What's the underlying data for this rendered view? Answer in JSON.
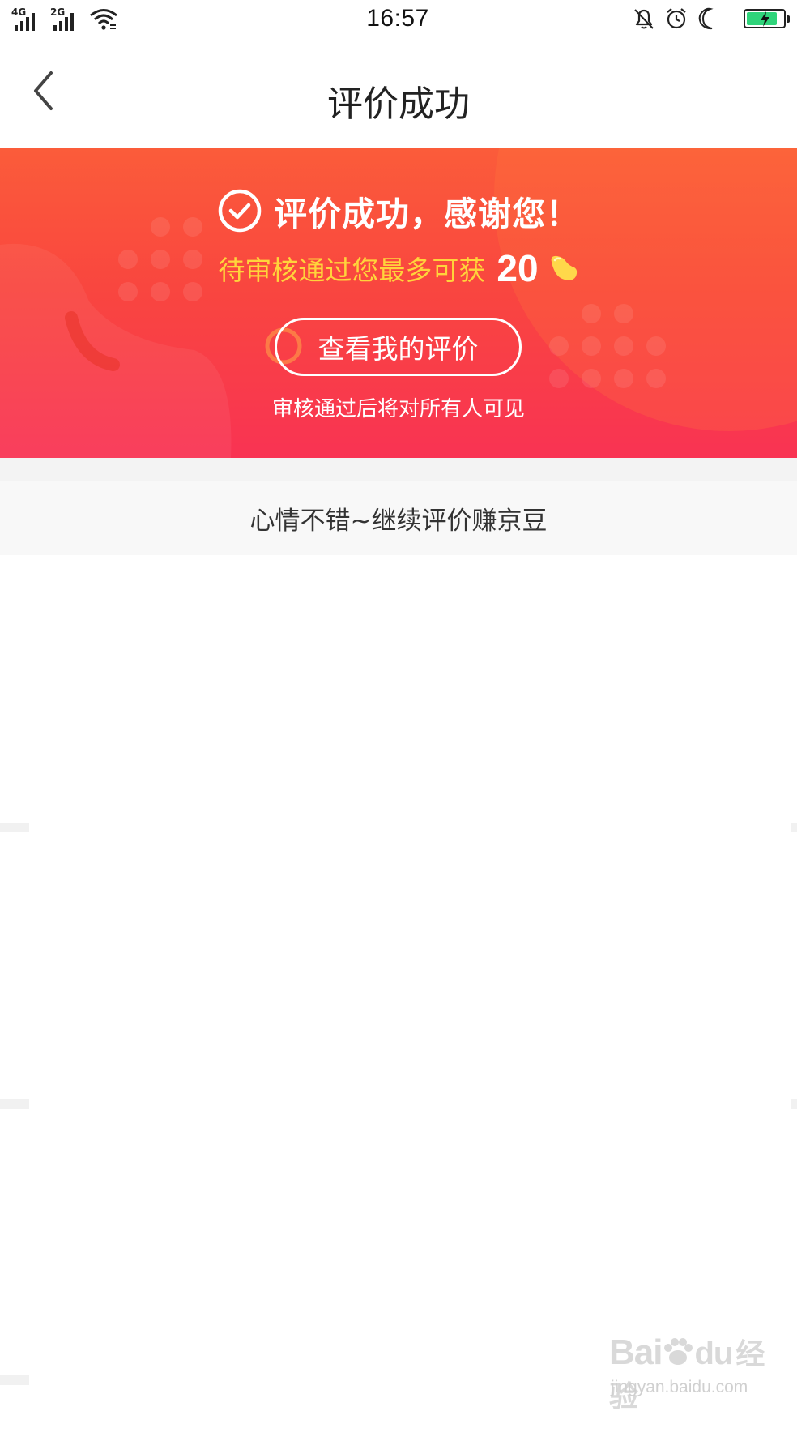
{
  "status_bar": {
    "network_1": "4G",
    "network_2": "2G",
    "time": "16:57",
    "battery_level": 0.85,
    "battery_color": "#2fd47a",
    "icons": [
      "signal-4g-icon",
      "signal-2g-icon",
      "wifi-icon",
      "bell-off-icon",
      "alarm-icon",
      "moon-icon",
      "battery-charging-icon"
    ]
  },
  "nav": {
    "title": "评价成功",
    "back_icon": "chevron-left-icon"
  },
  "banner": {
    "success_title": "评价成功，感谢您！",
    "reward_text": "待审核通过您最多可获",
    "reward_amount": "20",
    "reward_icon": "jingdou-bean-icon",
    "view_button": "查看我的评价",
    "visibility_note": "审核通过后将对所有人可见",
    "colors": {
      "gradient_top": "#fb5c3a",
      "gradient_bottom": "#f93353",
      "reward_text": "#ffd43b"
    }
  },
  "mood_prompt": "心情不错~继续评价赚京豆",
  "watermark": {
    "logo": "Bai",
    "logo_cn": "经验",
    "url": "jingyan.baidu.com"
  }
}
